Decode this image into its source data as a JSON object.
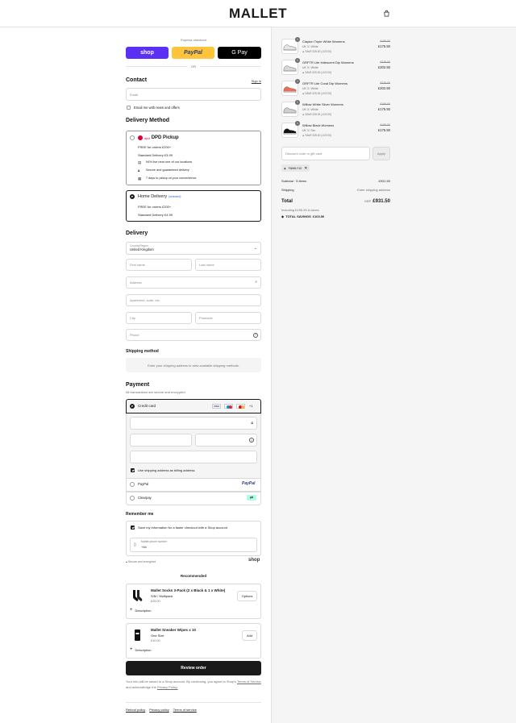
{
  "header": {
    "logo": "MALLET"
  },
  "express": {
    "title": "Express checkout",
    "shop_label": "shop",
    "paypal_label": "PayPal",
    "gpay_label": "G Pay",
    "or_label": "OR",
    "colors": {
      "shop": "#5a31f4",
      "paypal": "#ffc439",
      "gpay": "#000000"
    }
  },
  "contact": {
    "title": "Contact",
    "signin": "Sign in",
    "email_placeholder": "Email",
    "news_label": "Email me with news and offers"
  },
  "delivery_method": {
    "title": "Delivery Method",
    "dpd": {
      "logo": "dpd",
      "name": "DPD Pickup",
      "free": "FREE for orders £200+",
      "standard": "Standard Delivery £3.99",
      "features": [
        {
          "icon": "building-icon",
          "text": "94% live near one of our locations"
        },
        {
          "icon": "lock-icon",
          "text": "Secure and guaranteed delivery"
        },
        {
          "icon": "calendar-icon",
          "text": "7 days to pickup at your convenience"
        }
      ]
    },
    "home": {
      "name": "Home Delivery",
      "selected_tag": "(selected)",
      "free": "FREE for orders £200+",
      "standard": "Standard Delivery £4.99"
    }
  },
  "delivery": {
    "title": "Delivery",
    "country_label": "Country/Region",
    "country_value": "United Kingdom",
    "first_name": "First name",
    "last_name": "Last name",
    "address": "Address",
    "apartment": "Apartment, suite, etc.",
    "city": "City",
    "postcode": "Postcode",
    "phone": "Phone"
  },
  "shipping": {
    "title": "Shipping method",
    "message": "Enter your shipping address to view available shipping methods."
  },
  "payment": {
    "title": "Payment",
    "subtitle": "All transactions are secure and encrypted.",
    "credit_card": "Credit card",
    "more_cards": "+1",
    "billing_label": "Use shipping address as billing address",
    "paypal": "PayPal",
    "clearpay": "Clearpay"
  },
  "remember": {
    "title": "Remember me",
    "save_label": "Save my information for a faster checkout with a Shop account",
    "mobile_label": "Mobile phone number",
    "mobile_value": "+44",
    "secure_label": "Secure and encrypted",
    "shop_logo": "shop"
  },
  "recommended": {
    "title": "Recommended",
    "items": [
      {
        "name": "Mallet Socks 3-Pack (2 x Black & 1 x White)",
        "variant": "S/M / Multipack",
        "price": "£25.00",
        "button": "Options",
        "description": "Description"
      },
      {
        "name": "Mallet Sneaker Wipes x 10",
        "variant": "One Size",
        "price": "£10.00",
        "button": "Add",
        "description": "Description"
      }
    ]
  },
  "review_button": "Review order",
  "legal": {
    "text": "Your info will be saved to a Shop account. By continuing, you agree to Shop's",
    "terms": "Terms of Service",
    "and_ack": "and acknowledge the",
    "privacy": "Privacy Policy."
  },
  "footer_links": [
    "Refund policy",
    "Privacy policy",
    "Terms of service"
  ],
  "cart": {
    "items": [
      {
        "qty": "1",
        "name": "Clayton Triple White Womens",
        "variant": "UK 3 / White",
        "savings": "SAVE £25.00 (-£22.00)",
        "old_price": "£195.00",
        "price": "£175.50"
      },
      {
        "qty": "1",
        "name": "GRFTR Lite Iridescent Dip Womens",
        "variant": "UK 3 / White",
        "savings": "SAVE £25.00 (-£22.00)",
        "old_price": "£225.00",
        "price": "£202.50"
      },
      {
        "qty": "1",
        "name": "GRFTR Lite Coral Dip Womens",
        "variant": "UK 3 / White",
        "savings": "SAVE £25.00 (-£22.00)",
        "old_price": "£225.00",
        "price": "£202.50"
      },
      {
        "qty": "1",
        "name": "Willow White Silver Womens",
        "variant": "UK 3 / White",
        "savings": "SAVE £25.00 (-£22.00)",
        "old_price": "£195.00",
        "price": "£175.50"
      },
      {
        "qty": "1",
        "name": "Willow Black Womens",
        "variant": "UK 3 / Tan",
        "savings": "SAVE £25.00 (-£22.00)",
        "old_price": "£195.00",
        "price": "£175.50"
      }
    ],
    "discount_placeholder": "Discount code or gift card",
    "apply": "Apply",
    "code": "FAMILY10",
    "subtotal_label": "Subtotal · 5 items",
    "subtotal_value": "£931.50",
    "shipping_label": "Shipping",
    "shipping_value": "Enter shipping address",
    "total_label": "Total",
    "currency": "GBP",
    "total_value": "£931.50",
    "tax_note": "Including £155.25 in taxes",
    "savings_label": "TOTAL SAVINGS",
    "savings_value": "£103.50"
  }
}
